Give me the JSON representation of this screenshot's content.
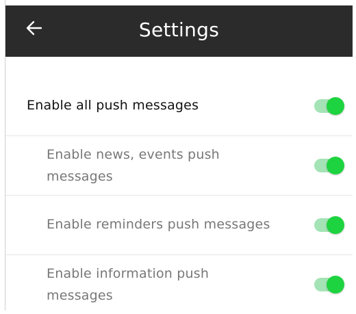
{
  "app_bar": {
    "title": "Settings",
    "back_icon": "arrow-left-icon",
    "background_color": "#2b2b2b",
    "title_color": "#ffffff"
  },
  "settings": [
    {
      "label": "Enable all push messages",
      "enabled": true
    },
    {
      "label": "Enable news, events push messages",
      "enabled": true
    },
    {
      "label": "Enable reminders push messages",
      "enabled": true
    },
    {
      "label": "Enable information push messages",
      "enabled": true
    }
  ],
  "colors": {
    "toggle_on_knob": "#1ed340",
    "toggle_on_track": "#a4e3b5",
    "sub_label": "#777777"
  }
}
